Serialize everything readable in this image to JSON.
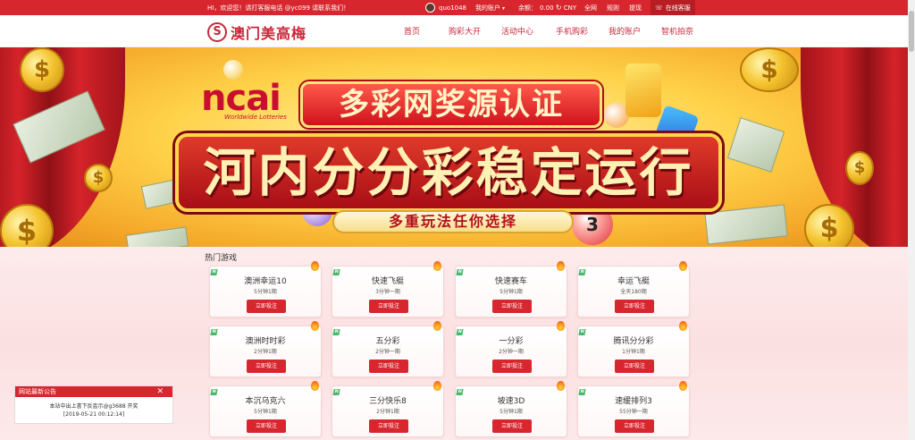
{
  "topbar": {
    "greeting": "HI，欢迎您！请打客服电话 @yc099 请联系我们！",
    "username": "quo1048",
    "account_label": "我的账户",
    "balance_label": "余额：",
    "balance_value": "0.00",
    "currency": "CNY",
    "links": [
      "全网",
      "规则",
      "提现"
    ],
    "customer_service": "在线客服"
  },
  "nav": {
    "logo_text": "澳门美高梅",
    "items": [
      "首页",
      "购彩大开",
      "活动中心",
      "手机购彩",
      "我的账户",
      "智机拍奈"
    ]
  },
  "banner": {
    "brand": "ncai",
    "brand_sub": "Worldwide Lotteries",
    "headline1": "多彩网奖源认证",
    "headline2": "河内分分彩稳定运行",
    "subtitle": "多重玩法任你选择",
    "ball_number": "3"
  },
  "hot_games": {
    "title": "热门游戏",
    "button_label": "立即投注",
    "badge": "N",
    "items": [
      {
        "name": "澳洲幸运10",
        "sub": "5分钟1期"
      },
      {
        "name": "快速飞艇",
        "sub": "3分钟一期"
      },
      {
        "name": "快速赛车",
        "sub": "5分钟1期"
      },
      {
        "name": "幸运飞艇",
        "sub": "全天180期"
      },
      {
        "name": "澳洲时时彩",
        "sub": "2分钟1期"
      },
      {
        "name": "五分彩",
        "sub": "2分钟一期"
      },
      {
        "name": "一分彩",
        "sub": "2分钟一期"
      },
      {
        "name": "腾讯分分彩",
        "sub": "1分钟1期"
      },
      {
        "name": "本沉乌克六",
        "sub": "5分钟1期"
      },
      {
        "name": "三分快乐8",
        "sub": "2分钟1期"
      },
      {
        "name": "坡速3D",
        "sub": "5分钟1期"
      },
      {
        "name": "速缓排列3",
        "sub": "55分钟一期"
      }
    ]
  },
  "notice": {
    "title": "网站最新公告",
    "line1": "本站中出上書下反盃示@g3688 开奖",
    "line2": "[2019-05-21 00:12:14]"
  },
  "colors": {
    "brand_red": "#d8262e",
    "logo_red": "#c8283a",
    "new_badge_green": "#49b86a"
  }
}
